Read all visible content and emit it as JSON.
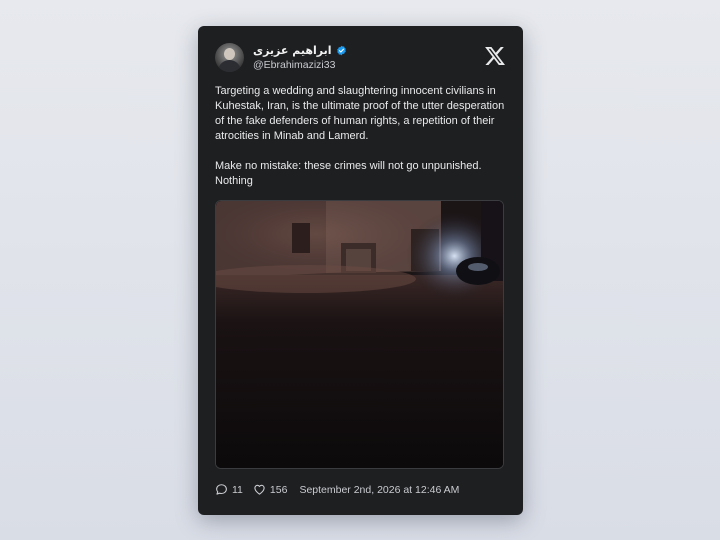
{
  "author": {
    "display_name": "ابراهیم عزیزی",
    "handle": "@Ebrahimazizi33",
    "verified": true,
    "avatar": "author-avatar-photo"
  },
  "platform": {
    "logo_icon": "x-logo-icon"
  },
  "tweet": {
    "paragraph_1": "Targeting a wedding and slaughtering innocent civilians in Kuhestak, Iran, is the ultimate proof of the utter desperation of the fake defenders of human rights, a repetition of their atrocities in Minab and Lamerd.",
    "paragraph_2": "Make no mistake: these crimes will not go unpunished. Nothing",
    "media": "night-street-video-frame"
  },
  "footer": {
    "replies_icon": "reply-bubble-icon",
    "replies": "11",
    "likes_icon": "heart-icon",
    "likes": "156",
    "timestamp": "September 2nd, 2026 at 12:46 AM"
  },
  "colors": {
    "card_background": "#1e1f21",
    "page_background": "#e2e5eb",
    "verified_blue": "#1d9bf0",
    "text_primary": "#e9eaec",
    "text_secondary": "#c9cbd0"
  }
}
